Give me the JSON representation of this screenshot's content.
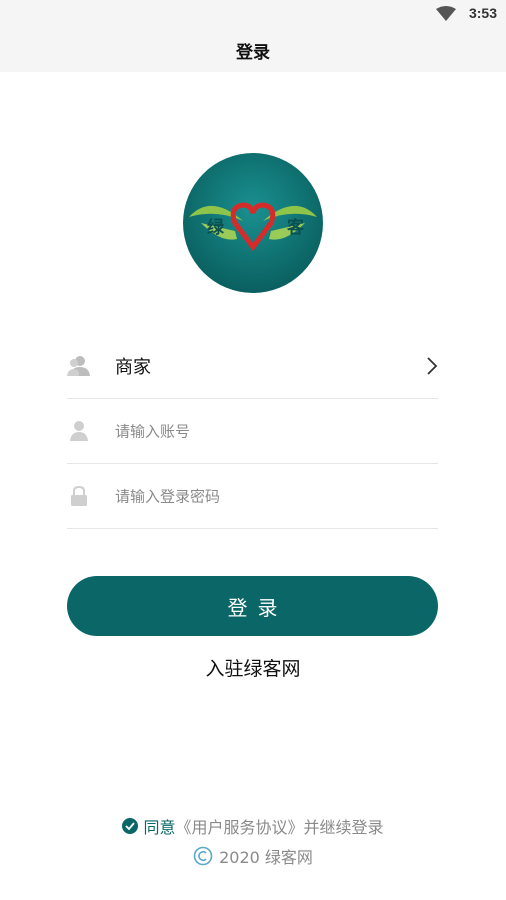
{
  "status_bar": {
    "time": "3:53"
  },
  "header": {
    "title": "登录"
  },
  "logo": {
    "text_left": "绿",
    "text_right": "客"
  },
  "form": {
    "role": {
      "label": "商家"
    },
    "account": {
      "placeholder": "请输入账号"
    },
    "password": {
      "placeholder": "请输入登录密码"
    }
  },
  "login_button": {
    "label": "登录"
  },
  "register_link": {
    "label": "入驻绿客网"
  },
  "agreement": {
    "agree_text": "同意",
    "terms_text": "《用户服务协议》并继续登录"
  },
  "footer": {
    "copyright": "2020 绿客网"
  },
  "colors": {
    "accent": "#0b6767",
    "logo_bg": "#0e7777",
    "heart": "#d62b2b",
    "leaf": "#7dbb3a"
  }
}
